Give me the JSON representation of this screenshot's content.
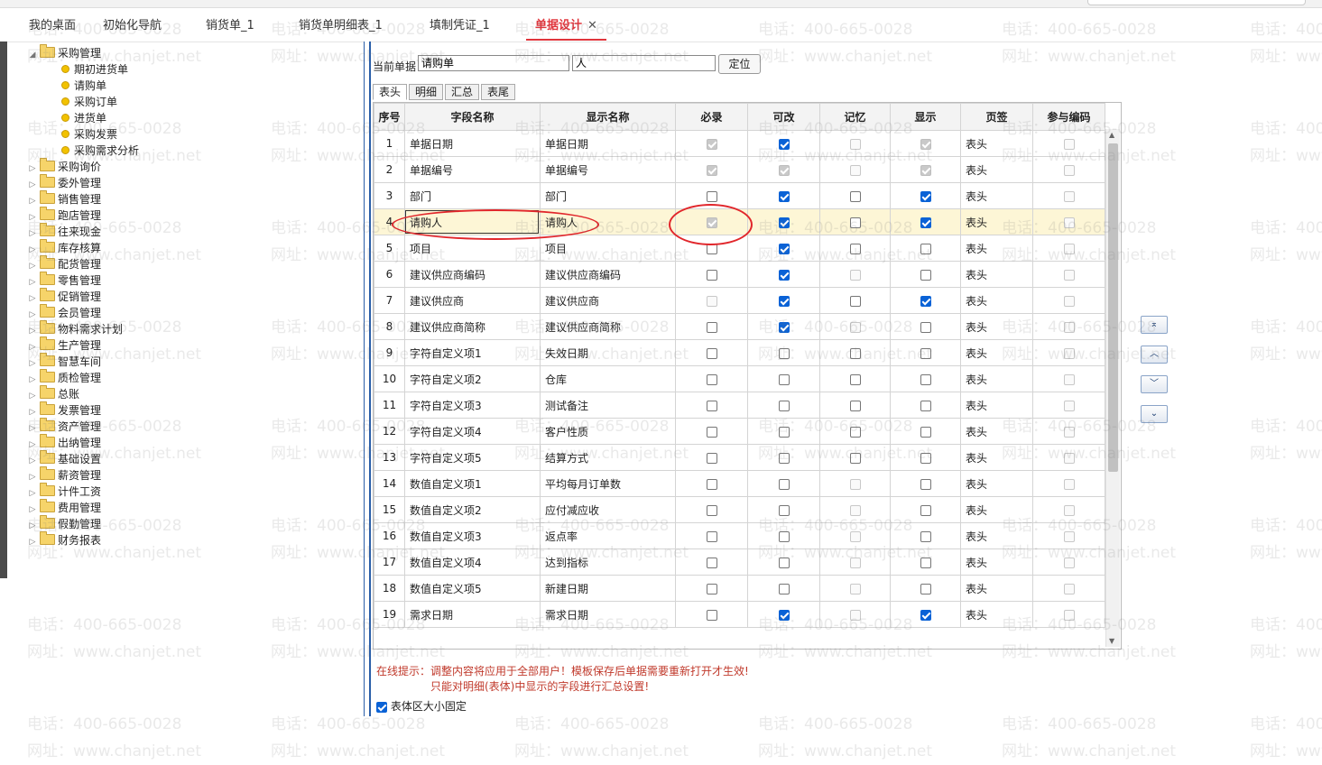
{
  "tabs": [
    {
      "label": "我的桌面",
      "active": false
    },
    {
      "label": "初始化导航",
      "active": false
    },
    {
      "label": "销货单_1",
      "active": false
    },
    {
      "label": "销货单明细表_1",
      "active": false
    },
    {
      "label": "填制凭证_1",
      "active": false
    },
    {
      "label": "单据设计",
      "active": true,
      "close": "✕"
    }
  ],
  "watermark": {
    "phone": "电话：400-665-0028",
    "site": "网址：www.chanjet.net"
  },
  "tree": {
    "expanded": {
      "label": "采购管理",
      "children": [
        "期初进货单",
        "请购单",
        "采购订单",
        "进货单",
        "采购发票",
        "采购需求分析"
      ]
    },
    "collapsed": [
      "采购询价",
      "委外管理",
      "销售管理",
      "跑店管理",
      "往来现金",
      "库存核算",
      "配货管理",
      "零售管理",
      "促销管理",
      "会员管理",
      "物料需求计划",
      "生产管理",
      "智慧车间",
      "质检管理",
      "总账",
      "发票管理",
      "资产管理",
      "出纳管理",
      "基础设置",
      "薪资管理",
      "计件工资",
      "费用管理",
      "假勤管理",
      "财务报表"
    ]
  },
  "toolbar": {
    "label": "当前单据",
    "doc_value": "请购单",
    "search_value": "人",
    "locate_button": "定位"
  },
  "subtabs": [
    "表头",
    "明细",
    "汇总",
    "表尾"
  ],
  "grid": {
    "columns": [
      "序号",
      "字段名称",
      "显示名称",
      "必录",
      "可改",
      "记忆",
      "显示",
      "页签",
      "参与编码"
    ],
    "selected_row": 4,
    "rows": [
      {
        "no": "1",
        "field": "单据日期",
        "display": "单据日期",
        "required": "dison",
        "editable": "on",
        "memory": "dis",
        "show": "dison",
        "page": "表头",
        "coding": "dis"
      },
      {
        "no": "2",
        "field": "单据编号",
        "display": "单据编号",
        "required": "dison",
        "editable": "dison",
        "memory": "dis",
        "show": "dison",
        "page": "表头",
        "coding": "dis"
      },
      {
        "no": "3",
        "field": "部门",
        "display": "部门",
        "required": "off",
        "editable": "on",
        "memory": "off",
        "show": "on",
        "page": "表头",
        "coding": "dis"
      },
      {
        "no": "4",
        "field": "请购人",
        "display": "请购人",
        "required": "dison",
        "editable": "on",
        "memory": "off",
        "show": "on",
        "page": "表头",
        "coding": "dis"
      },
      {
        "no": "5",
        "field": "项目",
        "display": "项目",
        "required": "off",
        "editable": "on",
        "memory": "off",
        "show": "off",
        "page": "表头",
        "coding": "dis"
      },
      {
        "no": "6",
        "field": "建议供应商编码",
        "display": "建议供应商编码",
        "required": "off",
        "editable": "on",
        "memory": "dis",
        "show": "off",
        "page": "表头",
        "coding": "dis"
      },
      {
        "no": "7",
        "field": "建议供应商",
        "display": "建议供应商",
        "required": "dis",
        "editable": "on",
        "memory": "off",
        "show": "on",
        "page": "表头",
        "coding": "dis"
      },
      {
        "no": "8",
        "field": "建议供应商简称",
        "display": "建议供应商简称",
        "required": "off",
        "editable": "on",
        "memory": "dis",
        "show": "off",
        "page": "表头",
        "coding": "dis"
      },
      {
        "no": "9",
        "field": "字符自定义项1",
        "display": "失效日期",
        "required": "off",
        "editable": "off",
        "memory": "off",
        "show": "off",
        "page": "表头",
        "coding": "dis"
      },
      {
        "no": "10",
        "field": "字符自定义项2",
        "display": "仓库",
        "required": "off",
        "editable": "off",
        "memory": "off",
        "show": "off",
        "page": "表头",
        "coding": "dis"
      },
      {
        "no": "11",
        "field": "字符自定义项3",
        "display": "测试备注",
        "required": "off",
        "editable": "off",
        "memory": "off",
        "show": "off",
        "page": "表头",
        "coding": "dis"
      },
      {
        "no": "12",
        "field": "字符自定义项4",
        "display": "客户性质",
        "required": "off",
        "editable": "off",
        "memory": "off",
        "show": "off",
        "page": "表头",
        "coding": "dis"
      },
      {
        "no": "13",
        "field": "字符自定义项5",
        "display": "结算方式",
        "required": "off",
        "editable": "off",
        "memory": "off",
        "show": "off",
        "page": "表头",
        "coding": "dis"
      },
      {
        "no": "14",
        "field": "数值自定义项1",
        "display": "平均每月订单数",
        "required": "off",
        "editable": "off",
        "memory": "dis",
        "show": "off",
        "page": "表头",
        "coding": "dis"
      },
      {
        "no": "15",
        "field": "数值自定义项2",
        "display": "应付减应收",
        "required": "off",
        "editable": "off",
        "memory": "dis",
        "show": "off",
        "page": "表头",
        "coding": "dis"
      },
      {
        "no": "16",
        "field": "数值自定义项3",
        "display": "返点率",
        "required": "off",
        "editable": "off",
        "memory": "dis",
        "show": "off",
        "page": "表头",
        "coding": "dis"
      },
      {
        "no": "17",
        "field": "数值自定义项4",
        "display": "达到指标",
        "required": "off",
        "editable": "off",
        "memory": "dis",
        "show": "off",
        "page": "表头",
        "coding": "dis"
      },
      {
        "no": "18",
        "field": "数值自定义项5",
        "display": "新建日期",
        "required": "off",
        "editable": "off",
        "memory": "dis",
        "show": "off",
        "page": "表头",
        "coding": "dis"
      },
      {
        "no": "19",
        "field": "需求日期",
        "display": "需求日期",
        "required": "off",
        "editable": "on",
        "memory": "dis",
        "show": "on",
        "page": "表头",
        "coding": "dis"
      }
    ]
  },
  "move_buttons": [
    "move-top",
    "move-up",
    "move-down",
    "move-bottom"
  ],
  "tips": {
    "line1": "在线提示：调整内容将应用于全部用户！模板保存后单据需要重新打开才生效!",
    "line2": "只能对明细(表体)中显示的字段进行汇总设置!"
  },
  "fixed_label": "表体区大小固定"
}
